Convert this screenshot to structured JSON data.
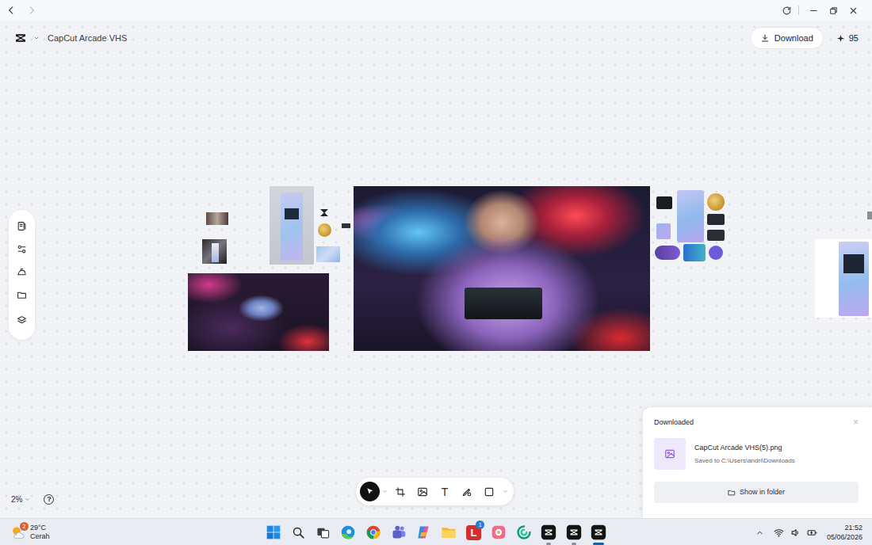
{
  "window": {
    "nav": [
      {
        "kind": "back",
        "disabled": false
      },
      {
        "kind": "forward",
        "disabled": true
      }
    ]
  },
  "header": {
    "project_title": "CapCut Arcade VHS",
    "download_label": "Download",
    "credits": "95"
  },
  "left_toolbar": [
    {
      "kind": "panel"
    },
    {
      "kind": "adjust"
    },
    {
      "kind": "stamp"
    },
    {
      "kind": "folder"
    },
    {
      "kind": "layers"
    }
  ],
  "bottom_toolbar": [
    {
      "kind": "select",
      "selected": true
    },
    {
      "kind": "chevron",
      "selected": false
    },
    {
      "kind": "frame",
      "selected": false
    },
    {
      "kind": "image",
      "selected": false
    },
    {
      "kind": "text",
      "glyph": "T",
      "selected": false
    },
    {
      "kind": "pen",
      "selected": false
    },
    {
      "kind": "shape",
      "selected": false
    },
    {
      "kind": "chevron",
      "selected": false
    }
  ],
  "zoom": {
    "value": "2%",
    "help": "?"
  },
  "download_toast": {
    "title": "Downloaded",
    "close": "×",
    "file_name": "CapCut Arcade VHS(5).png",
    "saved_to": "Saved to C:\\Users\\andri\\Downloads",
    "button": "Show in folder"
  },
  "taskbar": {
    "weather": {
      "temp": "29°C",
      "condition": "Cerah",
      "badge": "2"
    },
    "apps": [
      {
        "kind": "start",
        "running": false,
        "selected": false
      },
      {
        "kind": "search",
        "running": false,
        "selected": false
      },
      {
        "kind": "task-view",
        "running": false,
        "selected": false
      },
      {
        "kind": "edge",
        "running": false,
        "selected": false
      },
      {
        "kind": "chrome",
        "running": false,
        "selected": false
      },
      {
        "kind": "teams",
        "running": false,
        "selected": false
      },
      {
        "kind": "copilot",
        "running": false,
        "selected": false
      },
      {
        "kind": "explorer",
        "running": false,
        "selected": false
      },
      {
        "kind": "l-app",
        "glyph": "L",
        "badge": "1",
        "running": false,
        "selected": false
      },
      {
        "kind": "photos",
        "running": false,
        "selected": false
      },
      {
        "kind": "green-app",
        "running": false,
        "selected": false
      },
      {
        "kind": "capcut",
        "running": true,
        "selected": false
      },
      {
        "kind": "capcut",
        "running": true,
        "selected": false
      },
      {
        "kind": "capcut",
        "running": true,
        "selected": true
      }
    ],
    "clock": {
      "time": "21:52",
      "date": "05/06/2026"
    }
  }
}
